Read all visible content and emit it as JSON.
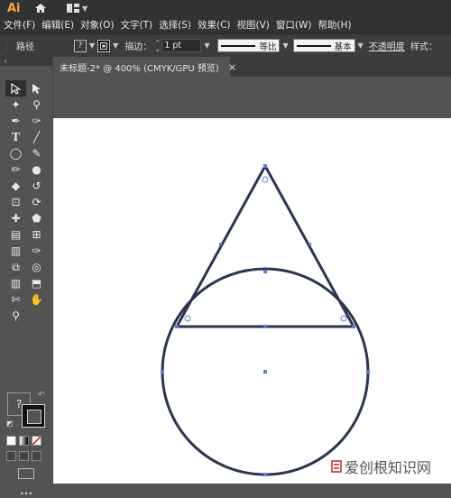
{
  "app": {
    "logo": "Ai"
  },
  "menu": [
    "文件(F)",
    "编辑(E)",
    "对象(O)",
    "文字(T)",
    "选择(S)",
    "效果(C)",
    "视图(V)",
    "窗口(W)",
    "帮助(H)"
  ],
  "control": {
    "selection_label": "路径",
    "fill_swatch": "?",
    "stroke_label": "描边：",
    "stroke_value": "1 pt",
    "profile_label": "等比",
    "brush_label": "基本",
    "opacity_label": "不透明度",
    "style_label": "样式："
  },
  "document": {
    "tab_title": "未标题-2* @ 400% (CMYK/GPU 预览)",
    "close_glyph": "×"
  },
  "tools": {
    "left": [
      "▶",
      "✦",
      "✎",
      "T",
      "○",
      "✐",
      "◇",
      "⊡",
      "✚",
      "▤",
      "■",
      "⧉",
      "▥",
      "✒",
      "🔍"
    ],
    "right": [
      "▷",
      "⚲",
      "✑",
      "╲",
      "✏",
      "⚫",
      "↺",
      "⟳",
      "⬟",
      "⬚",
      "✑",
      "◎",
      "⬒",
      "✋",
      ""
    ],
    "fill_placeholder": "?",
    "more": "•••"
  },
  "watermark": {
    "text": "爱创根知识网",
    "accent": "#c0262d"
  },
  "colors": {
    "accent": "#f7a43a",
    "stroke": "#2b3550",
    "anchor": "#5a7fd6"
  }
}
